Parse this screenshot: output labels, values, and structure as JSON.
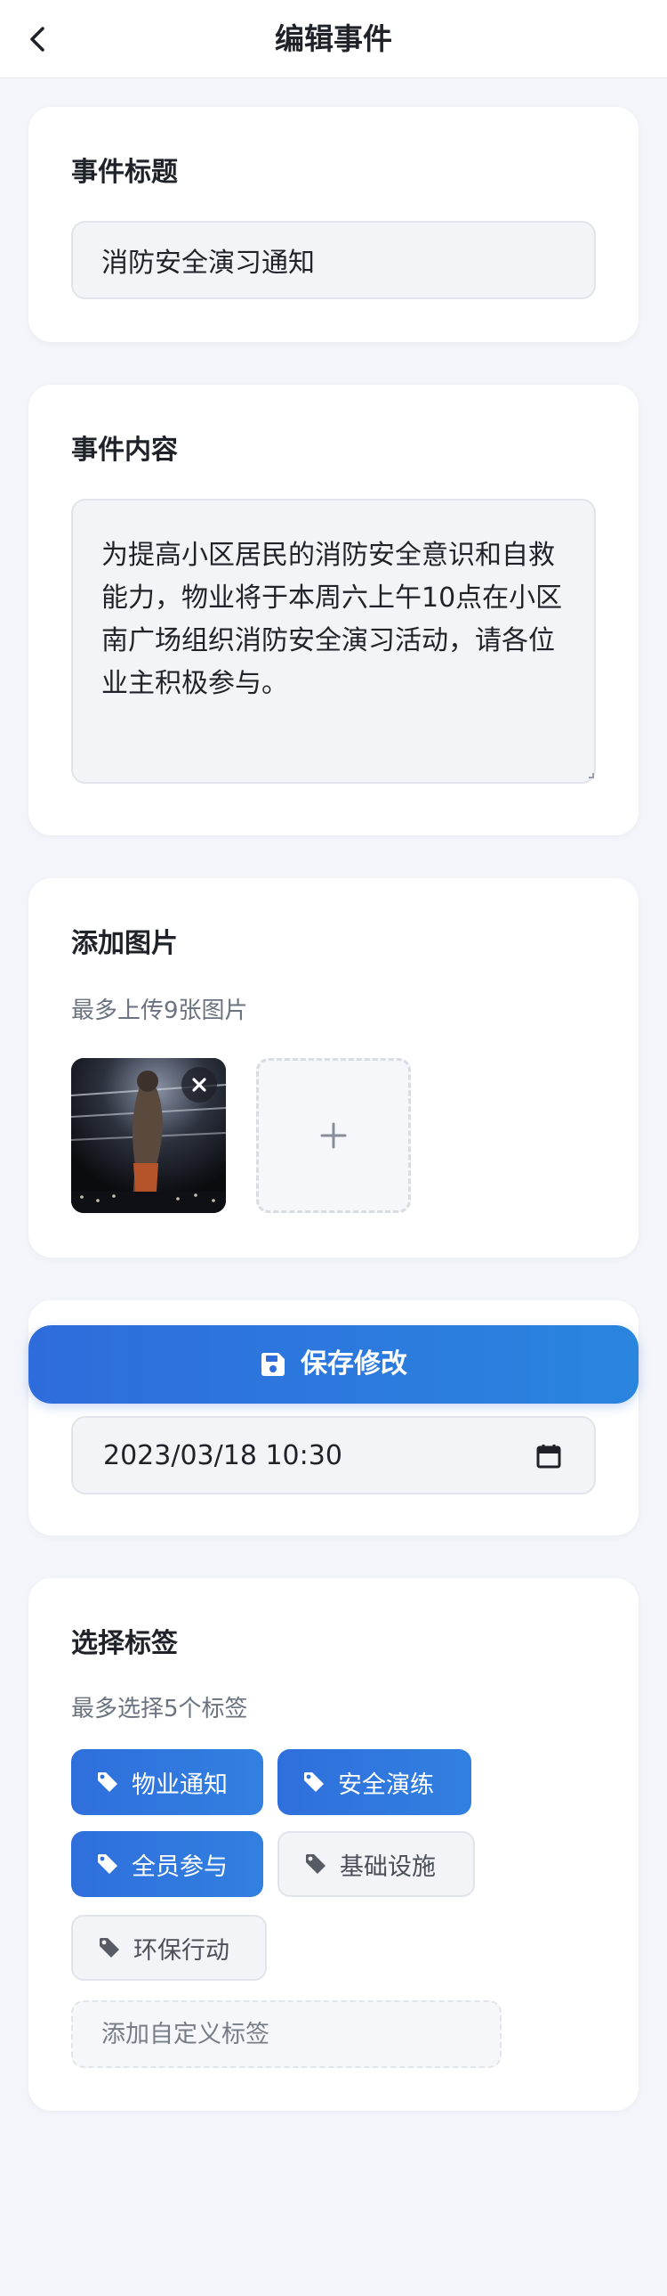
{
  "header": {
    "title": "编辑事件",
    "back_icon": "chevron-left-icon"
  },
  "event_title": {
    "label": "事件标题",
    "value": "消防安全演习通知"
  },
  "event_content": {
    "label": "事件内容",
    "value": "为提高小区居民的消防安全意识和自救能力，物业将于本周六上午10点在小区南广场组织消防安全演习活动，请各位业主积极参与。"
  },
  "images": {
    "label": "添加图片",
    "hint": "最多上传9张图片",
    "remove_icon": "close-icon",
    "add_icon": "plus-icon"
  },
  "save_button": {
    "label": "保存修改",
    "icon": "floppy-disk-icon",
    "color": "#2e6cdc"
  },
  "datetime": {
    "value": "2023/03/18 10:30",
    "icon": "calendar-icon"
  },
  "tags": {
    "label": "选择标签",
    "hint": "最多选择5个标签",
    "icon": "tag-icon",
    "active_color": "#2f6fdc",
    "items": [
      {
        "label": "物业通知",
        "selected": true
      },
      {
        "label": "安全演练",
        "selected": true
      },
      {
        "label": "全员参与",
        "selected": true
      },
      {
        "label": "基础设施",
        "selected": false
      },
      {
        "label": "环保行动",
        "selected": false
      }
    ],
    "custom_placeholder": "添加自定义标签"
  }
}
